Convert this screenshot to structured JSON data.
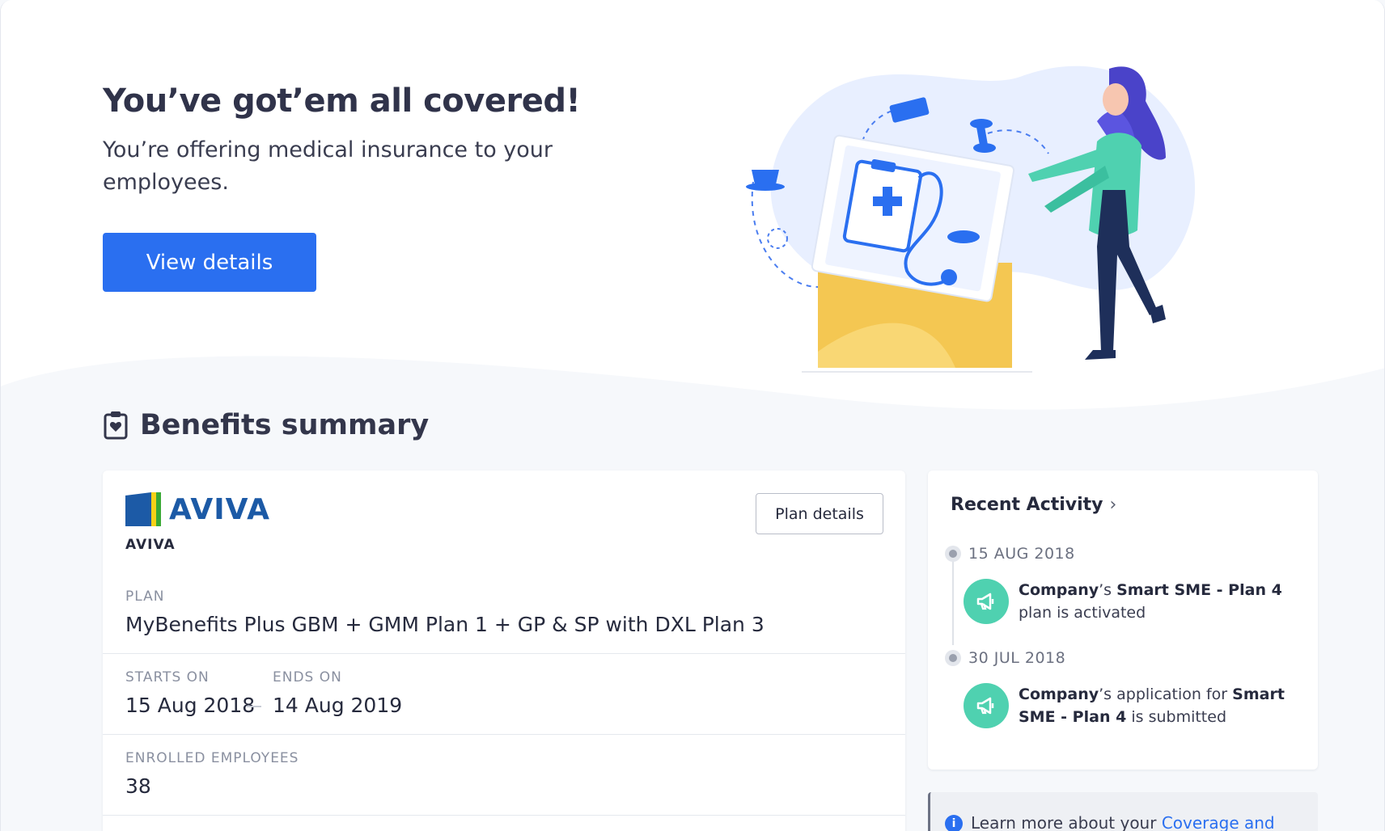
{
  "hero": {
    "title": "You’ve got’em all covered!",
    "subtitle": "You’re offering medical insurance to your employees.",
    "button_label": "View details"
  },
  "benefits": {
    "section_title": "Benefits summary",
    "insurer_logo_text": "AVIVA",
    "insurer_name": "AVIVA",
    "plan_details_label": "Plan details",
    "plan_label": "PLAN",
    "plan_value": "MyBenefits Plus GBM + GMM Plan 1 + GP & SP with DXL Plan 3",
    "starts_label": "STARTS ON",
    "starts_value": "15 Aug 2018",
    "ends_label": "ENDS ON",
    "ends_value": "14 Aug 2019",
    "enrolled_label": "ENROLLED EMPLOYEES",
    "enrolled_value": "38"
  },
  "activity": {
    "title": "Recent Activity",
    "items": [
      {
        "date": "15 AUG 2018",
        "company": "Company",
        "text_1": "’s ",
        "plan": "Smart SME - Plan 4",
        "text_2": " plan is activated"
      },
      {
        "date": "30 JUL 2018",
        "company": "Company",
        "text_1": "’s application for ",
        "plan": "Smart SME - Plan 4",
        "text_2": " is submitted"
      }
    ]
  },
  "learn": {
    "prefix": "Learn more about your ",
    "link": "Coverage and"
  },
  "colors": {
    "primary": "#2a6ff0",
    "activity_icon": "#4fd1b0",
    "aviva_blue": "#1c5aa6",
    "aviva_yellow": "#f7d117",
    "aviva_green": "#3aa935"
  }
}
